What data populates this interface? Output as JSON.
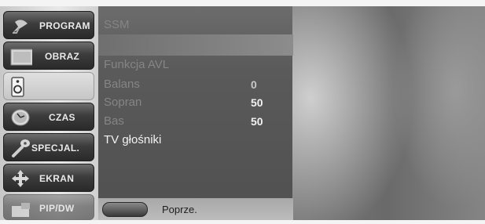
{
  "menu": {
    "items": [
      {
        "label": "PROGRAM",
        "icon": "satellite-dish-icon",
        "state": "normal"
      },
      {
        "label": "OBRAZ",
        "icon": "picture-frame-icon",
        "state": "normal"
      },
      {
        "label": "",
        "icon": "speaker-icon",
        "state": "selected"
      },
      {
        "label": "CZAS",
        "icon": "clock-icon",
        "state": "normal"
      },
      {
        "label": "SPECJAL.",
        "icon": "key-icon",
        "state": "normal"
      },
      {
        "label": "EKRAN",
        "icon": "move-arrows-icon",
        "state": "normal"
      },
      {
        "label": "PIP/DW",
        "icon": "pip-icon",
        "state": "dimmed"
      }
    ]
  },
  "submenu": {
    "highlighted_item": "",
    "items": [
      {
        "label": "SSM",
        "value": "",
        "style": "dim"
      },
      {
        "label": "Funkcja AVL",
        "value": "",
        "style": "dim"
      },
      {
        "label": "Balans",
        "value": "0",
        "style": "dim"
      },
      {
        "label": "Sopran",
        "value": "50",
        "style": "dim"
      },
      {
        "label": "Bas",
        "value": "50",
        "style": "dim"
      },
      {
        "label": "TV głośniki",
        "value": "",
        "style": "bright"
      }
    ]
  },
  "footer": {
    "prev_label": "Poprze."
  },
  "colors": {
    "menu_button_dark": "#3c3c3c",
    "menu_button_selected": "#d0d0d0",
    "submenu_bg": "#5a5a5a",
    "text_bright": "#f2f2f2",
    "text_dim": "#858585"
  }
}
